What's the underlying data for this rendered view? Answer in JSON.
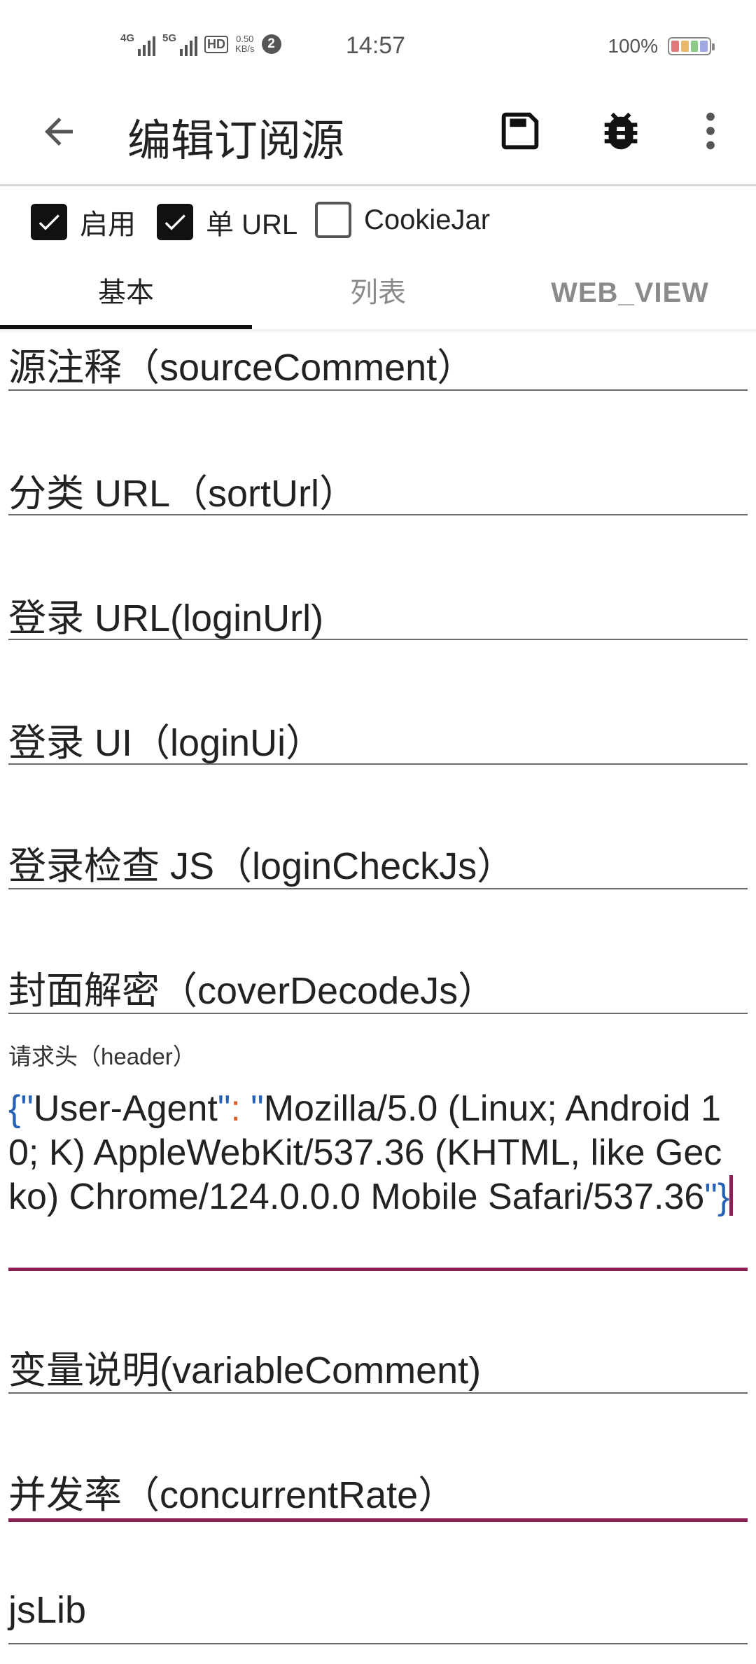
{
  "status_bar": {
    "net1": "4G",
    "net2": "5G",
    "hd": "HD",
    "speed_value": "0.50",
    "speed_unit": "KB/s",
    "notification_count": "2",
    "time": "14:57",
    "battery": "100%",
    "battery_colors": [
      "#e07a7a",
      "#e9b86a",
      "#8cc98a",
      "#9fa8e0"
    ]
  },
  "toolbar": {
    "title": "编辑订阅源",
    "back_icon": "arrow-left-icon",
    "save_icon": "save-icon",
    "debug_icon": "bug-icon",
    "more_icon": "more-vert-icon"
  },
  "options": {
    "enable_label": "启用",
    "enable_checked": true,
    "single_url_label": "单 URL",
    "single_url_checked": true,
    "cookiejar_label": "CookieJar",
    "cookiejar_checked": false
  },
  "tabs": [
    {
      "label": "基本",
      "active": true
    },
    {
      "label": "列表",
      "active": false
    },
    {
      "label": "WEB_VIEW",
      "active": false
    }
  ],
  "fields": {
    "source_comment": "源注释（sourceComment）",
    "sort_url": "分类 URL（sortUrl）",
    "login_url": "登录 URL(loginUrl)",
    "login_ui": "登录 UI（loginUi）",
    "login_check_js": "登录检查 JS（loginCheckJs）",
    "cover_decode_js": "封面解密（coverDecodeJs）",
    "header_label": "请求头（header）",
    "header_value": "{\"User-Agent\": \"Mozilla/5.0 (Linux; Android 10; K) AppleWebKit/537.36 (KHTML, like Gecko) Chrome/124.0.0.0 Mobile Safari/537.36\"}",
    "header_key": "User-Agent",
    "header_ua": "Mozilla/5.0 (Linux; Android 10; K) AppleWebKit/537.36 (KHTML, like Gecko) Chrome/124.0.0.0 Mobile Safari/537.36",
    "variable_comment": "变量说明(variableComment)",
    "concurrent_rate": "并发率（concurrentRate）",
    "js_lib": "jsLib"
  },
  "colors": {
    "accent": "#8b1e52",
    "json_brace": "#2561b5",
    "json_operator": "#d4622b"
  }
}
